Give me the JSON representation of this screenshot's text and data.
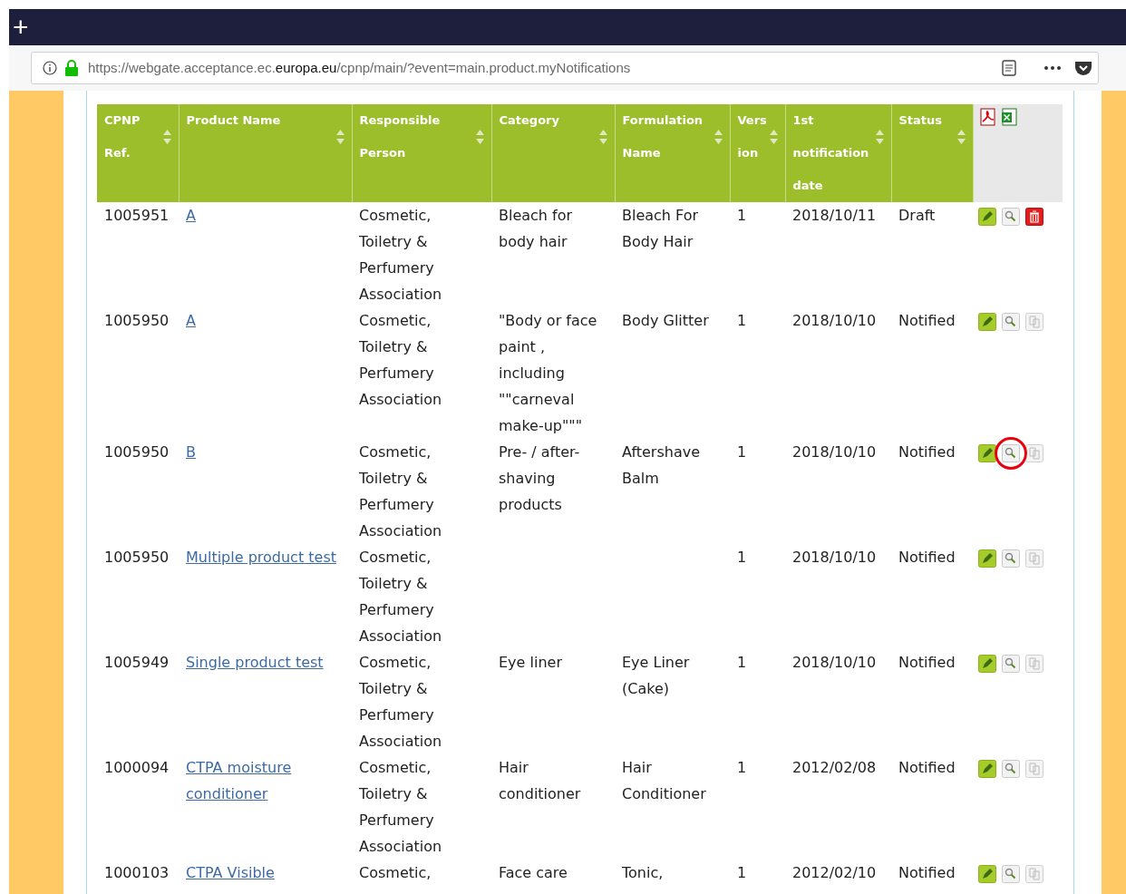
{
  "browser": {
    "new_tab": "+",
    "url_prefix": "https://webgate.acceptance.ec.",
    "url_domain": "europa.eu",
    "url_path": "/cpnp/main/?event=main.product.myNotifications"
  },
  "table": {
    "columns": [
      "CPNP Ref.",
      "Product Name",
      "Responsible Person",
      "Category",
      "Formulation Name",
      "Version",
      "1st notification date",
      "Status"
    ],
    "rows": [
      {
        "ref": "1005951",
        "product": "A",
        "person": "Cosmetic, Toiletry & Perfumery Association",
        "category": "Bleach for body hair",
        "formulation": "Bleach For Body Hair",
        "version": "1",
        "date": "2018/10/11",
        "status": "Draft",
        "kind": "delete",
        "highlighted": false
      },
      {
        "ref": "1005950",
        "product": "A",
        "person": "Cosmetic, Toiletry & Perfumery Association",
        "category": "\"Body or face paint , including \"\"carneval make-up\"\"\"",
        "formulation": "Body Glitter",
        "version": "1",
        "date": "2018/10/10",
        "status": "Notified",
        "kind": "copy",
        "highlighted": false
      },
      {
        "ref": "1005950",
        "product": "B",
        "person": "Cosmetic, Toiletry & Perfumery Association",
        "category": "Pre- / after-shaving products",
        "formulation": "Aftershave Balm",
        "version": "1",
        "date": "2018/10/10",
        "status": "Notified",
        "kind": "copy",
        "highlighted": true
      },
      {
        "ref": "1005950",
        "product": "Multiple product test",
        "person": "Cosmetic, Toiletry & Perfumery Association",
        "category": "",
        "formulation": "",
        "version": "1",
        "date": "2018/10/10",
        "status": "Notified",
        "kind": "copy",
        "highlighted": false
      },
      {
        "ref": "1005949",
        "product": "Single product test",
        "person": "Cosmetic, Toiletry & Perfumery Association",
        "category": "Eye liner",
        "formulation": "Eye Liner (Cake)",
        "version": "1",
        "date": "2018/10/10",
        "status": "Notified",
        "kind": "copy",
        "highlighted": false
      },
      {
        "ref": "1000094",
        "product": "CTPA moisture conditioner",
        "person": "Cosmetic, Toiletry & Perfumery Association",
        "category": "Hair conditioner",
        "formulation": "Hair Conditioner",
        "version": "1",
        "date": "2012/02/08",
        "status": "Notified",
        "kind": "copy",
        "highlighted": false
      },
      {
        "ref": "1000103",
        "product": "CTPA Visible",
        "person": "Cosmetic,",
        "category": "Face care",
        "formulation": "Tonic,",
        "version": "1",
        "date": "2012/02/10",
        "status": "Notified",
        "kind": "copy",
        "highlighted": false
      }
    ]
  }
}
